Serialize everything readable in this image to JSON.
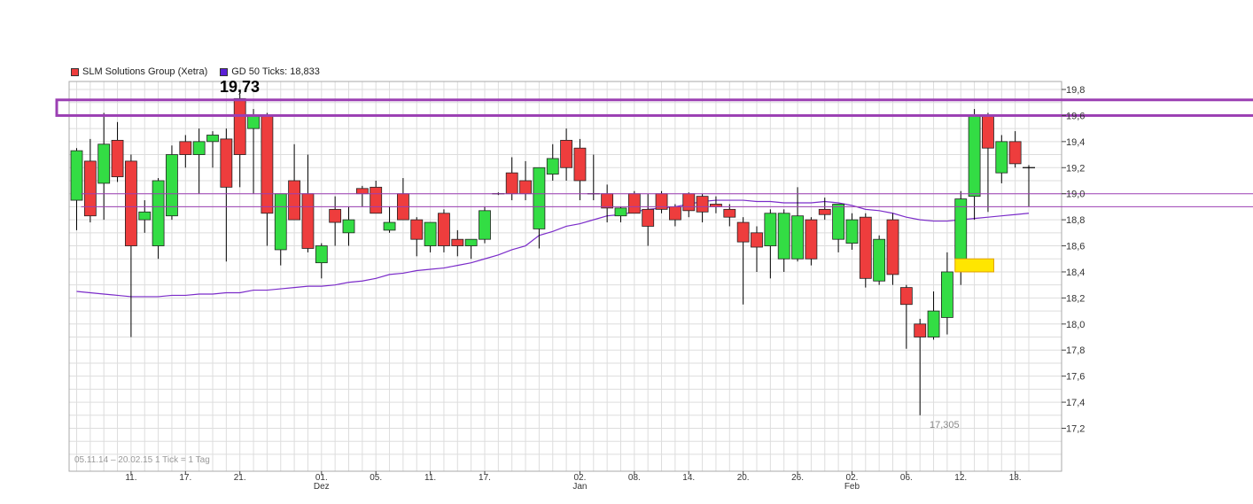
{
  "legend": {
    "series_label": "SLM Solutions Group (Xetra)",
    "ma_label": "GD 50 Ticks: 18,833"
  },
  "annotations": {
    "high": "19,73",
    "low": "17,305",
    "range": "05.11.14 – 20.02.15   1 Tick = 1 Tag"
  },
  "colors": {
    "up": "#33dd44",
    "down": "#ee3d3d",
    "ma": "#7b2cc9",
    "resistance": "#9b3fb3",
    "grid": "#dddddd",
    "highlight": "#ffe600"
  },
  "chart_data": {
    "type": "candlestick",
    "ylim": [
      17.0,
      19.9
    ],
    "y_ticks": [
      "19,8",
      "19,6",
      "19,4",
      "19,2",
      "19,0",
      "18,8",
      "18,6",
      "18,4",
      "18,2",
      "18,0",
      "17,8",
      "17,6",
      "17,4",
      "17,2"
    ],
    "y_tick_values": [
      19.8,
      19.6,
      19.4,
      19.2,
      19.0,
      18.8,
      18.6,
      18.4,
      18.2,
      18.0,
      17.8,
      17.6,
      17.4,
      17.2
    ],
    "x_ticks": [
      {
        "label": "11.",
        "index": 4,
        "sub": ""
      },
      {
        "label": "17.",
        "index": 8,
        "sub": ""
      },
      {
        "label": "21.",
        "index": 12,
        "sub": ""
      },
      {
        "label": "01.",
        "index": 18,
        "sub": "Dez"
      },
      {
        "label": "05.",
        "index": 22,
        "sub": ""
      },
      {
        "label": "11.",
        "index": 26,
        "sub": ""
      },
      {
        "label": "17.",
        "index": 30,
        "sub": ""
      },
      {
        "label": "02.",
        "index": 37,
        "sub": "Jan"
      },
      {
        "label": "08.",
        "index": 41,
        "sub": ""
      },
      {
        "label": "14.",
        "index": 45,
        "sub": ""
      },
      {
        "label": "20.",
        "index": 49,
        "sub": ""
      },
      {
        "label": "26.",
        "index": 53,
        "sub": ""
      },
      {
        "label": "02.",
        "index": 57,
        "sub": "Feb"
      },
      {
        "label": "06.",
        "index": 61,
        "sub": ""
      },
      {
        "label": "12.",
        "index": 65,
        "sub": ""
      },
      {
        "label": "18.",
        "index": 69,
        "sub": ""
      }
    ],
    "candles": [
      [
        18.95,
        19.35,
        18.72,
        19.33
      ],
      [
        19.25,
        19.42,
        18.78,
        18.83
      ],
      [
        19.08,
        19.62,
        18.8,
        19.38
      ],
      [
        19.41,
        19.55,
        19.09,
        19.13
      ],
      [
        19.25,
        19.3,
        17.9,
        18.6
      ],
      [
        18.8,
        18.95,
        18.7,
        18.86
      ],
      [
        18.6,
        19.12,
        18.5,
        19.1
      ],
      [
        18.83,
        19.37,
        18.8,
        19.3
      ],
      [
        19.4,
        19.45,
        19.2,
        19.3
      ],
      [
        19.3,
        19.5,
        19.0,
        19.4
      ],
      [
        19.4,
        19.48,
        19.2,
        19.45
      ],
      [
        19.42,
        19.5,
        18.48,
        19.05
      ],
      [
        19.73,
        19.76,
        19.05,
        19.3
      ],
      [
        19.5,
        19.65,
        19.0,
        19.6
      ],
      [
        19.6,
        19.62,
        18.6,
        18.85
      ],
      [
        18.57,
        18.98,
        18.45,
        19.0
      ],
      [
        19.1,
        19.38,
        18.9,
        18.8
      ],
      [
        19.0,
        19.3,
        18.55,
        18.58
      ],
      [
        18.47,
        18.62,
        18.35,
        18.6
      ],
      [
        18.88,
        18.98,
        18.6,
        18.78
      ],
      [
        18.7,
        18.9,
        18.6,
        18.8
      ],
      [
        19.04,
        19.06,
        18.9,
        19.0
      ],
      [
        19.05,
        19.1,
        18.85,
        18.85
      ],
      [
        18.72,
        18.9,
        18.7,
        18.78
      ],
      [
        19.0,
        19.12,
        18.8,
        18.8
      ],
      [
        18.8,
        18.82,
        18.52,
        18.65
      ],
      [
        18.6,
        18.78,
        18.55,
        18.78
      ],
      [
        18.85,
        18.88,
        18.55,
        18.6
      ],
      [
        18.65,
        18.72,
        18.52,
        18.6
      ],
      [
        18.6,
        18.65,
        18.5,
        18.65
      ],
      [
        18.65,
        18.9,
        18.62,
        18.87
      ],
      [
        19.0,
        19.01,
        18.99,
        19.0
      ],
      [
        19.16,
        19.28,
        18.95,
        19.0
      ],
      [
        19.1,
        19.25,
        18.95,
        19.0
      ],
      [
        18.73,
        19.0,
        18.58,
        19.2
      ],
      [
        19.15,
        19.38,
        19.1,
        19.27
      ],
      [
        19.41,
        19.5,
        19.1,
        19.2
      ],
      [
        19.35,
        19.42,
        18.95,
        19.1
      ],
      [
        19.0,
        19.3,
        18.95,
        19.0
      ],
      [
        19.0,
        19.07,
        18.78,
        18.89
      ],
      [
        18.83,
        18.9,
        18.78,
        18.89
      ],
      [
        19.0,
        19.02,
        18.85,
        18.85
      ],
      [
        18.88,
        19.0,
        18.6,
        18.75
      ],
      [
        19.0,
        19.02,
        18.85,
        18.88
      ],
      [
        18.9,
        18.92,
        18.75,
        18.8
      ],
      [
        19.0,
        19.01,
        18.82,
        18.87
      ],
      [
        18.98,
        19.0,
        18.78,
        18.86
      ],
      [
        18.92,
        18.98,
        18.85,
        18.9
      ],
      [
        18.88,
        18.92,
        18.75,
        18.82
      ],
      [
        18.78,
        18.82,
        18.15,
        18.63
      ],
      [
        18.7,
        18.75,
        18.4,
        18.59
      ],
      [
        18.6,
        18.88,
        18.35,
        18.85
      ],
      [
        18.5,
        18.88,
        18.4,
        18.85
      ],
      [
        18.5,
        19.05,
        18.48,
        18.83
      ],
      [
        18.8,
        18.82,
        18.45,
        18.5
      ],
      [
        18.88,
        18.97,
        18.8,
        18.84
      ],
      [
        18.65,
        18.92,
        18.55,
        18.92
      ],
      [
        18.62,
        18.85,
        18.57,
        18.8
      ],
      [
        18.82,
        18.85,
        18.28,
        18.35
      ],
      [
        18.33,
        18.68,
        18.3,
        18.65
      ],
      [
        18.8,
        18.85,
        18.3,
        18.38
      ],
      [
        18.28,
        18.3,
        17.81,
        18.15
      ],
      [
        18.0,
        18.04,
        17.3,
        17.9
      ],
      [
        17.9,
        18.25,
        17.88,
        18.1
      ],
      [
        18.05,
        18.55,
        17.92,
        18.4
      ],
      [
        18.5,
        19.02,
        18.3,
        18.96
      ],
      [
        18.98,
        19.65,
        18.8,
        19.6
      ],
      [
        19.6,
        19.62,
        18.86,
        19.35
      ],
      [
        19.16,
        19.45,
        19.08,
        19.4
      ],
      [
        19.4,
        19.48,
        19.2,
        19.23
      ],
      [
        19.2,
        19.22,
        18.9,
        19.19
      ]
    ],
    "ma_values": [
      18.25,
      18.24,
      18.23,
      18.22,
      18.21,
      18.21,
      18.21,
      18.22,
      18.22,
      18.23,
      18.23,
      18.24,
      18.24,
      18.26,
      18.26,
      18.27,
      18.28,
      18.29,
      18.29,
      18.3,
      18.32,
      18.33,
      18.35,
      18.38,
      18.39,
      18.41,
      18.42,
      18.43,
      18.45,
      18.47,
      18.5,
      18.53,
      18.57,
      18.6,
      18.68,
      18.71,
      18.75,
      18.77,
      18.8,
      18.83,
      18.84,
      18.86,
      18.88,
      18.89,
      18.9,
      18.92,
      18.94,
      18.95,
      18.95,
      18.95,
      18.94,
      18.94,
      18.93,
      18.93,
      18.93,
      18.94,
      18.93,
      18.91,
      18.88,
      18.87,
      18.85,
      18.82,
      18.8,
      18.79,
      18.79,
      18.8,
      18.81,
      18.82,
      18.83,
      18.84,
      18.85
    ],
    "resistance_band": [
      19.6,
      19.72
    ],
    "reference_lines": [
      19.0,
      18.9
    ],
    "highlight_zone": {
      "from_index": 65,
      "to_index": 67,
      "low": 18.4,
      "high": 18.5
    }
  }
}
